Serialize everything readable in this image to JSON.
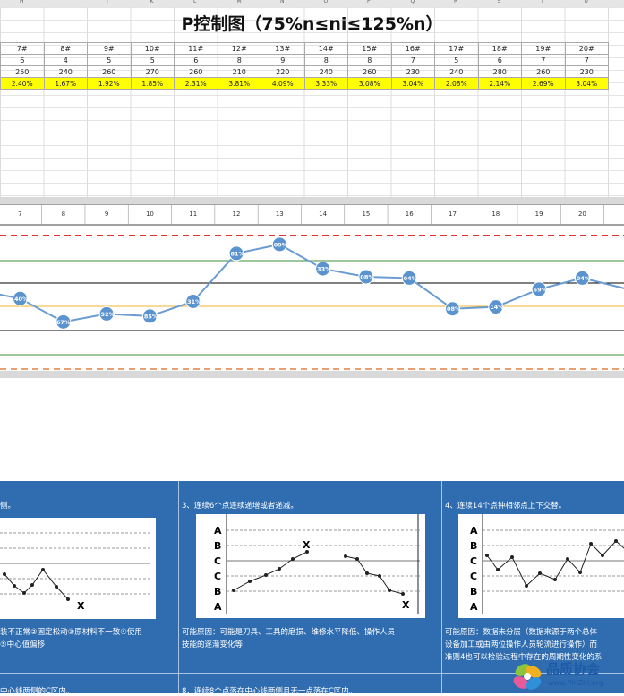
{
  "spreadsheet": {
    "column_letters": [
      "H",
      "I",
      "J",
      "K",
      "L",
      "M",
      "N",
      "O",
      "P",
      "Q",
      "R",
      "S",
      "T",
      "U"
    ],
    "title": "P控制图（75%n≤ni≤125%n）",
    "table": {
      "sample_ids": [
        "7#",
        "8#",
        "9#",
        "10#",
        "11#",
        "12#",
        "13#",
        "14#",
        "15#",
        "16#",
        "17#",
        "18#",
        "19#",
        "20#"
      ],
      "defects": [
        "6",
        "4",
        "5",
        "5",
        "6",
        "8",
        "9",
        "8",
        "8",
        "7",
        "5",
        "6",
        "7",
        "7"
      ],
      "sample_sizes": [
        "250",
        "240",
        "260",
        "270",
        "260",
        "210",
        "220",
        "240",
        "260",
        "230",
        "240",
        "280",
        "260",
        "230"
      ],
      "percents": [
        "2.40%",
        "1.67%",
        "1.92%",
        "1.85%",
        "2.31%",
        "3.81%",
        "4.09%",
        "3.33%",
        "3.08%",
        "3.04%",
        "2.08%",
        "2.14%",
        "2.69%",
        "3.04%"
      ]
    }
  },
  "chart_data": {
    "type": "line",
    "categories": [
      "7",
      "8",
      "9",
      "10",
      "11",
      "12",
      "13",
      "14",
      "15",
      "16",
      "17",
      "18",
      "19",
      "20"
    ],
    "series": [
      {
        "values": [
          2.4,
          1.67,
          1.92,
          1.85,
          2.31,
          3.81,
          4.09,
          3.33,
          3.08,
          3.04,
          2.08,
          2.14,
          2.69,
          3.04
        ]
      }
    ],
    "point_labels": [
      ".40%",
      "67%",
      ".92%",
      ".85%",
      ".31%",
      ".81%",
      ".09%",
      ".33%",
      ".08%",
      ".04%",
      ".08%",
      ".14%",
      ".69%",
      ".04%"
    ],
    "ylim": [
      0,
      6
    ],
    "colors": {
      "line": "#6a9bd1",
      "marker": "#5b93cf",
      "ucl": "#e03030",
      "center": "#f2b630",
      "zone": "#3c8f3c",
      "sigma1": "#000000"
    }
  },
  "panels": [
    {
      "title": "侧。",
      "text": [
        "装不正常②固定松动③原材料不一致④使用",
        "⑤中心值偏移"
      ],
      "next_title": "中心线两侧的C区内。"
    },
    {
      "title": "3、连续6个点连续递增或者递减。",
      "zones": [
        "A",
        "B",
        "C",
        "C",
        "B",
        "A"
      ],
      "mark": "X",
      "text": [
        "可能原因：可能是刀具、工具的磨损、维修水平降低、操作人员",
        "技能的逐渐变化等"
      ],
      "next_title": "8、连续8个点落在中心线两侧且无一点落在C区内。"
    },
    {
      "title": "4、连续14个点钟相邻点上下交替。",
      "zones": [
        "A",
        "B",
        "C",
        "C",
        "B",
        "A"
      ],
      "text": [
        "可能原因：数据未分层（数据来源于两个总体",
        "设备加工或由两位操作人员轮流进行操作）而",
        "准则4也可以检验过程中存在的周期性变化的系"
      ]
    }
  ],
  "watermark": {
    "name": "品质协会",
    "url": "www.PinZhi.org"
  }
}
